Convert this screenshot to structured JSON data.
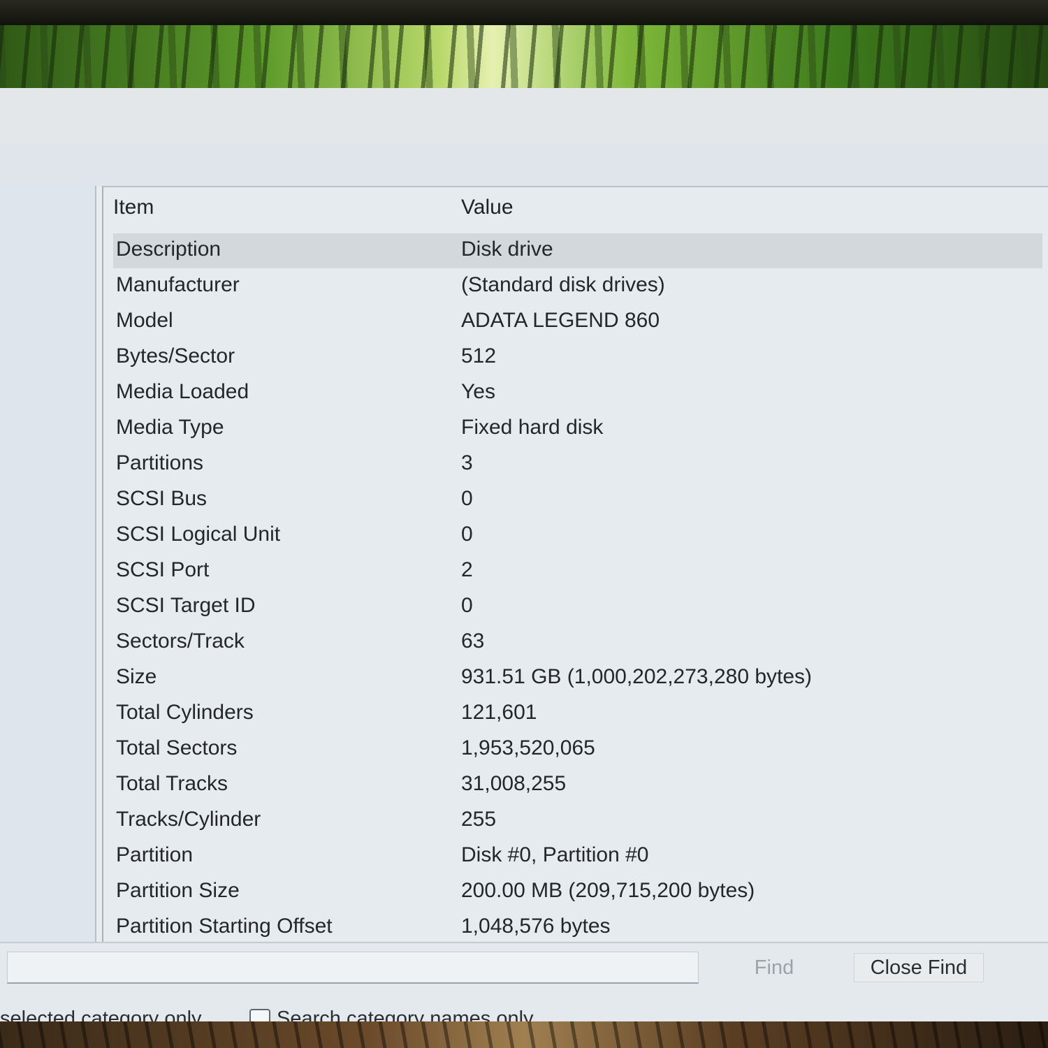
{
  "columns": {
    "item": "Item",
    "value": "Value"
  },
  "rows": [
    {
      "item": "Description",
      "value": "Disk drive"
    },
    {
      "item": "Manufacturer",
      "value": "(Standard disk drives)"
    },
    {
      "item": "Model",
      "value": "ADATA LEGEND 860"
    },
    {
      "item": "Bytes/Sector",
      "value": "512"
    },
    {
      "item": "Media Loaded",
      "value": "Yes"
    },
    {
      "item": "Media Type",
      "value": "Fixed hard disk"
    },
    {
      "item": "Partitions",
      "value": "3"
    },
    {
      "item": "SCSI Bus",
      "value": "0"
    },
    {
      "item": "SCSI Logical Unit",
      "value": "0"
    },
    {
      "item": "SCSI Port",
      "value": "2"
    },
    {
      "item": "SCSI Target ID",
      "value": "0"
    },
    {
      "item": "Sectors/Track",
      "value": "63"
    },
    {
      "item": "Size",
      "value": "931.51 GB (1,000,202,273,280 bytes)"
    },
    {
      "item": "Total Cylinders",
      "value": "121,601"
    },
    {
      "item": "Total Sectors",
      "value": "1,953,520,065"
    },
    {
      "item": "Total Tracks",
      "value": "31,008,255"
    },
    {
      "item": "Tracks/Cylinder",
      "value": "255"
    },
    {
      "item": "Partition",
      "value": "Disk #0, Partition #0"
    },
    {
      "item": "Partition Size",
      "value": "200.00 MB (209,715,200 bytes)"
    },
    {
      "item": "Partition Starting Offset",
      "value": "1,048,576 bytes"
    }
  ],
  "selected_row": "Description",
  "find": {
    "input_value": "",
    "find_label": "Find",
    "close_find_label": "Close Find",
    "option_selected_category": "selected category only",
    "option_category_names": "Search category names only",
    "category_names_checked": false
  }
}
